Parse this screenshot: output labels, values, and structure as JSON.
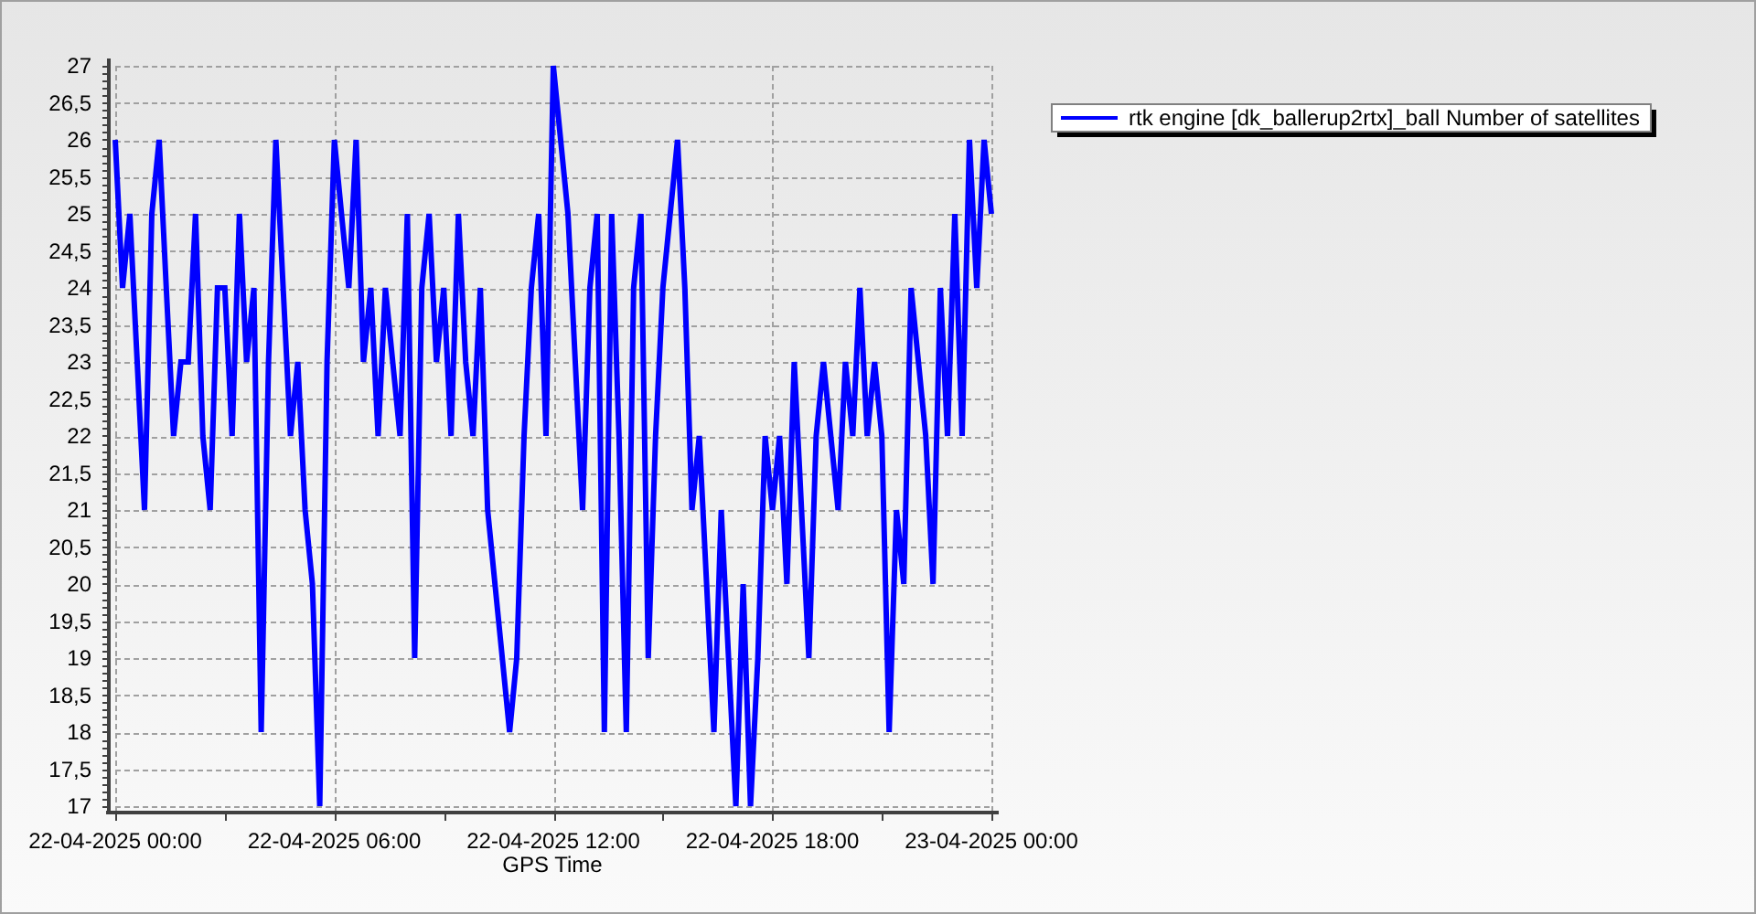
{
  "chart": {
    "chart_data": {
      "type": "line",
      "grid": true,
      "xlabel": "GPS Time",
      "ylim": [
        17,
        27
      ],
      "categories": [
        "22-04-2025 00:00",
        null,
        null,
        null,
        null,
        null,
        null,
        null,
        null,
        null,
        null,
        null,
        null,
        null,
        null,
        null,
        null,
        null,
        null,
        null,
        null,
        null,
        null,
        null,
        null,
        null,
        null,
        null,
        null,
        null,
        "22-04-2025 06:00",
        null,
        null,
        null,
        null,
        null,
        null,
        null,
        null,
        null,
        null,
        null,
        null,
        null,
        null,
        null,
        null,
        null,
        null,
        null,
        null,
        null,
        null,
        null,
        null,
        null,
        null,
        null,
        null,
        null,
        "22-04-2025 12:00",
        null,
        null,
        null,
        null,
        null,
        null,
        null,
        null,
        null,
        null,
        null,
        null,
        null,
        null,
        null,
        null,
        null,
        null,
        null,
        null,
        null,
        null,
        null,
        null,
        null,
        null,
        null,
        null,
        null,
        "22-04-2025 18:00",
        null,
        null,
        null,
        null,
        null,
        null,
        null,
        null,
        null,
        null,
        null,
        null,
        null,
        null,
        null,
        null,
        null,
        null,
        null,
        null,
        null,
        null,
        null,
        null,
        null,
        null,
        null,
        null,
        null,
        "23-04-2025 00:00"
      ],
      "yticks": [
        {
          "value": 17,
          "label": "17"
        },
        {
          "value": 17.5,
          "label": "17,5"
        },
        {
          "value": 18,
          "label": "18"
        },
        {
          "value": 18.5,
          "label": "18,5"
        },
        {
          "value": 19,
          "label": "19"
        },
        {
          "value": 19.5,
          "label": "19,5"
        },
        {
          "value": 20,
          "label": "20"
        },
        {
          "value": 20.5,
          "label": "20,5"
        },
        {
          "value": 21,
          "label": "21"
        },
        {
          "value": 21.5,
          "label": "21,5"
        },
        {
          "value": 22,
          "label": "22"
        },
        {
          "value": 22.5,
          "label": "22,5"
        },
        {
          "value": 23,
          "label": "23"
        },
        {
          "value": 23.5,
          "label": "23,5"
        },
        {
          "value": 24,
          "label": "24"
        },
        {
          "value": 24.5,
          "label": "24,5"
        },
        {
          "value": 25,
          "label": "25"
        },
        {
          "value": 25.5,
          "label": "25,5"
        },
        {
          "value": 26,
          "label": "26"
        },
        {
          "value": 26.5,
          "label": "26,5"
        },
        {
          "value": 27,
          "label": "27"
        }
      ],
      "series": [
        {
          "name": "rtk engine [dk_ballerup2rtx]_ball Number of satellites",
          "color": "#0000ff",
          "values": [
            26,
            24,
            25,
            23,
            21,
            25,
            26,
            24,
            22,
            23,
            23,
            25,
            22,
            21,
            24,
            24,
            22,
            25,
            23,
            24,
            18,
            23,
            26,
            24,
            22,
            23,
            21,
            20,
            17,
            23,
            26,
            25,
            24,
            26,
            23,
            24,
            22,
            24,
            23,
            22,
            25,
            19,
            24,
            25,
            23,
            24,
            22,
            25,
            23,
            22,
            24,
            21,
            20,
            19,
            18,
            19,
            22,
            24,
            25,
            22,
            27,
            26,
            25,
            23,
            21,
            24,
            25,
            18,
            25,
            22,
            18,
            24,
            25,
            19,
            22,
            24,
            25,
            26,
            24,
            21,
            22,
            20,
            18,
            21,
            19,
            17,
            20,
            17,
            19,
            22,
            21,
            22,
            20,
            23,
            21,
            19,
            22,
            23,
            22,
            21,
            23,
            22,
            24,
            22,
            23,
            22,
            18,
            21,
            20,
            24,
            23,
            22,
            20,
            24,
            22,
            25,
            22,
            26,
            24,
            26,
            25
          ]
        }
      ]
    }
  }
}
